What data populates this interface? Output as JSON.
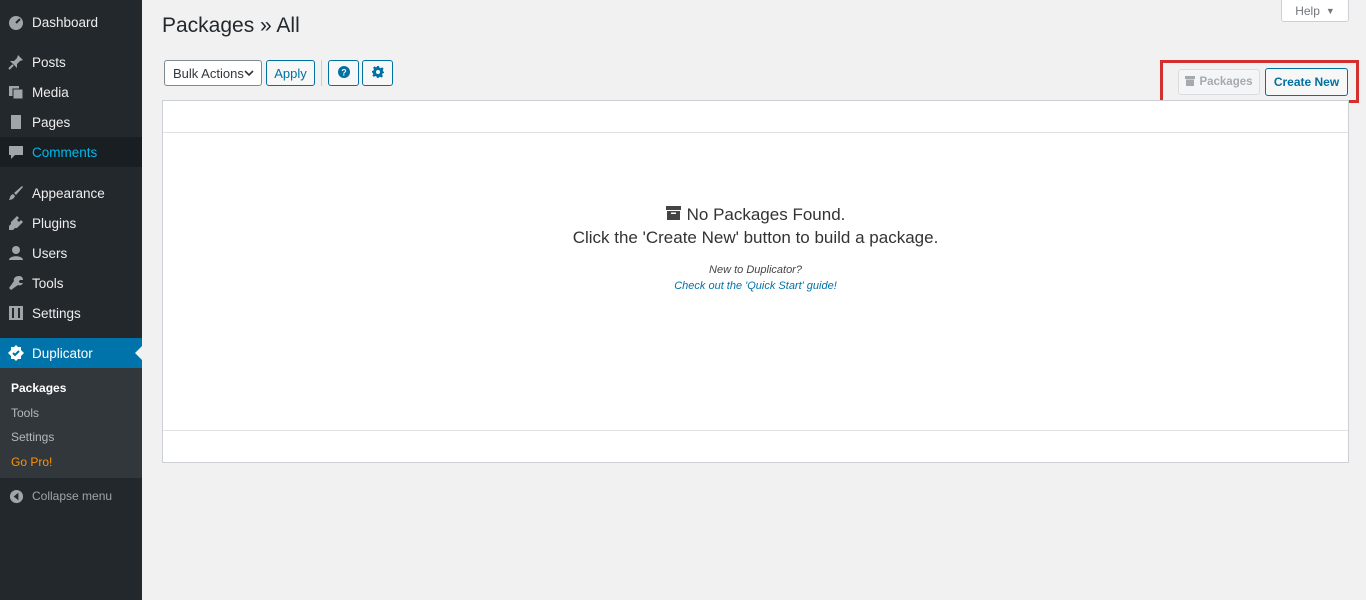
{
  "sidebar": {
    "items": [
      {
        "label": "Dashboard",
        "icon": "dashboard-icon"
      },
      {
        "label": "Posts",
        "icon": "pin-icon"
      },
      {
        "label": "Media",
        "icon": "media-icon"
      },
      {
        "label": "Pages",
        "icon": "page-icon"
      },
      {
        "label": "Comments",
        "icon": "comment-icon"
      },
      {
        "label": "Appearance",
        "icon": "brush-icon"
      },
      {
        "label": "Plugins",
        "icon": "plugin-icon"
      },
      {
        "label": "Users",
        "icon": "user-icon"
      },
      {
        "label": "Tools",
        "icon": "wrench-icon"
      },
      {
        "label": "Settings",
        "icon": "settings-icon"
      },
      {
        "label": "Duplicator",
        "icon": "duplicator-icon"
      }
    ],
    "submenu": [
      "Packages",
      "Tools",
      "Settings",
      "Go Pro!"
    ],
    "collapse": "Collapse menu"
  },
  "header": {
    "help": "Help",
    "title": "Packages » All"
  },
  "toolbar": {
    "bulk_actions": "Bulk Actions",
    "apply": "Apply",
    "packages": "Packages",
    "create_new": "Create New"
  },
  "empty_state": {
    "title": "No Packages Found.",
    "subtitle": "Click the 'Create New' button to build a package.",
    "new_to": "New to Duplicator?",
    "quick_start": "Check out the 'Quick Start' guide!"
  },
  "colors": {
    "sidebar_bg": "#23282d",
    "active_bg": "#0073aa",
    "accent": "#0071a1",
    "highlight_box": "#d32f2f",
    "go_pro": "#ff9300"
  }
}
